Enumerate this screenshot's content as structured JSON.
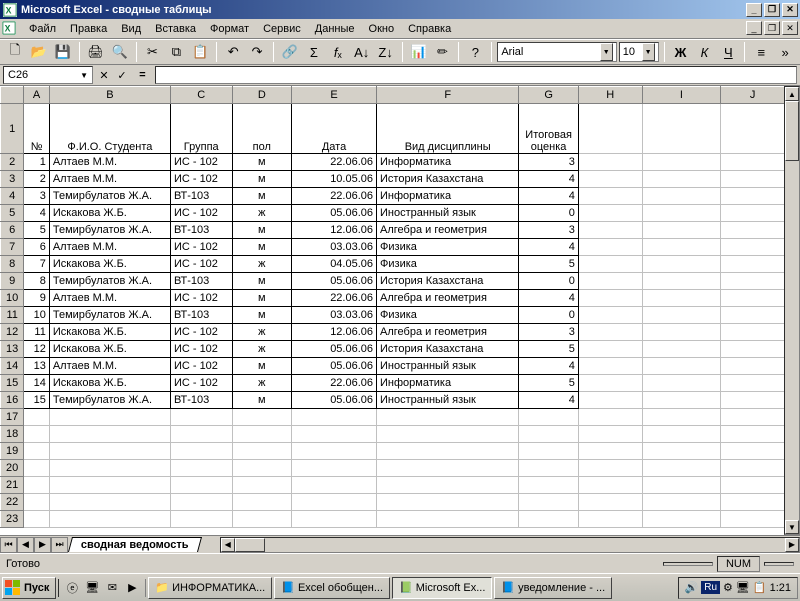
{
  "window": {
    "title": "Microsoft Excel - сводные таблицы"
  },
  "menu": {
    "items": [
      "Файл",
      "Правка",
      "Вид",
      "Вставка",
      "Формат",
      "Сервис",
      "Данные",
      "Окно",
      "Справка"
    ]
  },
  "format_toolbar": {
    "font": "Arial",
    "size": "10"
  },
  "namebox": {
    "ref": "C26",
    "fx": "="
  },
  "columns": [
    "A",
    "B",
    "C",
    "D",
    "E",
    "F",
    "G",
    "H",
    "I",
    "J"
  ],
  "headers": {
    "A": "№",
    "B": "Ф.И.О. Студента",
    "C": "Группа",
    "D": "пол",
    "E": "Дата",
    "F": "Вид дисциплины",
    "G": "Итоговая оценка"
  },
  "rows": [
    {
      "n": "1",
      "fio": "Алтаев М.М.",
      "grp": "ИС - 102",
      "sex": "м",
      "date": "22.06.06",
      "disc": "Информатика",
      "mark": "3"
    },
    {
      "n": "2",
      "fio": "Алтаев М.М.",
      "grp": "ИС - 102",
      "sex": "м",
      "date": "10.05.06",
      "disc": "История Казахстана",
      "mark": "4"
    },
    {
      "n": "3",
      "fio": "Темирбулатов Ж.А.",
      "grp": "ВТ-103",
      "sex": "м",
      "date": "22.06.06",
      "disc": "Информатика",
      "mark": "4"
    },
    {
      "n": "4",
      "fio": "Искакова Ж.Б.",
      "grp": "ИС - 102",
      "sex": "ж",
      "date": "05.06.06",
      "disc": "Иностранный язык",
      "mark": "0"
    },
    {
      "n": "5",
      "fio": "Темирбулатов Ж.А.",
      "grp": "ВТ-103",
      "sex": "м",
      "date": "12.06.06",
      "disc": "Алгебра и геометрия",
      "mark": "3"
    },
    {
      "n": "6",
      "fio": "Алтаев М.М.",
      "grp": "ИС - 102",
      "sex": "м",
      "date": "03.03.06",
      "disc": "Физика",
      "mark": "4"
    },
    {
      "n": "7",
      "fio": "Искакова Ж.Б.",
      "grp": "ИС - 102",
      "sex": "ж",
      "date": "04.05.06",
      "disc": "Физика",
      "mark": "5"
    },
    {
      "n": "8",
      "fio": "Темирбулатов Ж.А.",
      "grp": "ВТ-103",
      "sex": "м",
      "date": "05.06.06",
      "disc": "История Казахстана",
      "mark": "0"
    },
    {
      "n": "9",
      "fio": "Алтаев М.М.",
      "grp": "ИС - 102",
      "sex": "м",
      "date": "22.06.06",
      "disc": "Алгебра и геометрия",
      "mark": "4"
    },
    {
      "n": "10",
      "fio": "Темирбулатов Ж.А.",
      "grp": "ВТ-103",
      "sex": "м",
      "date": "03.03.06",
      "disc": "Физика",
      "mark": "0"
    },
    {
      "n": "11",
      "fio": "Искакова Ж.Б.",
      "grp": "ИС - 102",
      "sex": "ж",
      "date": "12.06.06",
      "disc": "Алгебра и геометрия",
      "mark": "3"
    },
    {
      "n": "12",
      "fio": "Искакова Ж.Б.",
      "grp": "ИС - 102",
      "sex": "ж",
      "date": "05.06.06",
      "disc": "История Казахстана",
      "mark": "5"
    },
    {
      "n": "13",
      "fio": "Алтаев М.М.",
      "grp": "ИС - 102",
      "sex": "м",
      "date": "05.06.06",
      "disc": "Иностранный язык",
      "mark": "4"
    },
    {
      "n": "14",
      "fio": "Искакова Ж.Б.",
      "grp": "ИС - 102",
      "sex": "ж",
      "date": "22.06.06",
      "disc": "Информатика",
      "mark": "5"
    },
    {
      "n": "15",
      "fio": "Темирбулатов Ж.А.",
      "grp": "ВТ-103",
      "sex": "м",
      "date": "05.06.06",
      "disc": "Иностранный язык",
      "mark": "4"
    }
  ],
  "empty_row_start": 17,
  "empty_row_end": 23,
  "sheet_tab": "сводная ведомость",
  "statusbar": {
    "ready": "Готово",
    "num": "NUM"
  },
  "taskbar": {
    "start": "Пуск",
    "tasks": [
      {
        "label": "ИНФОРМАТИКА...",
        "active": false,
        "icon": "folder"
      },
      {
        "label": "Excel обобщен...",
        "active": false,
        "icon": "word"
      },
      {
        "label": "Microsoft Ex...",
        "active": true,
        "icon": "excel"
      },
      {
        "label": "уведомление - ...",
        "active": false,
        "icon": "word"
      }
    ],
    "lang": "Ru",
    "clock": "1:21"
  }
}
